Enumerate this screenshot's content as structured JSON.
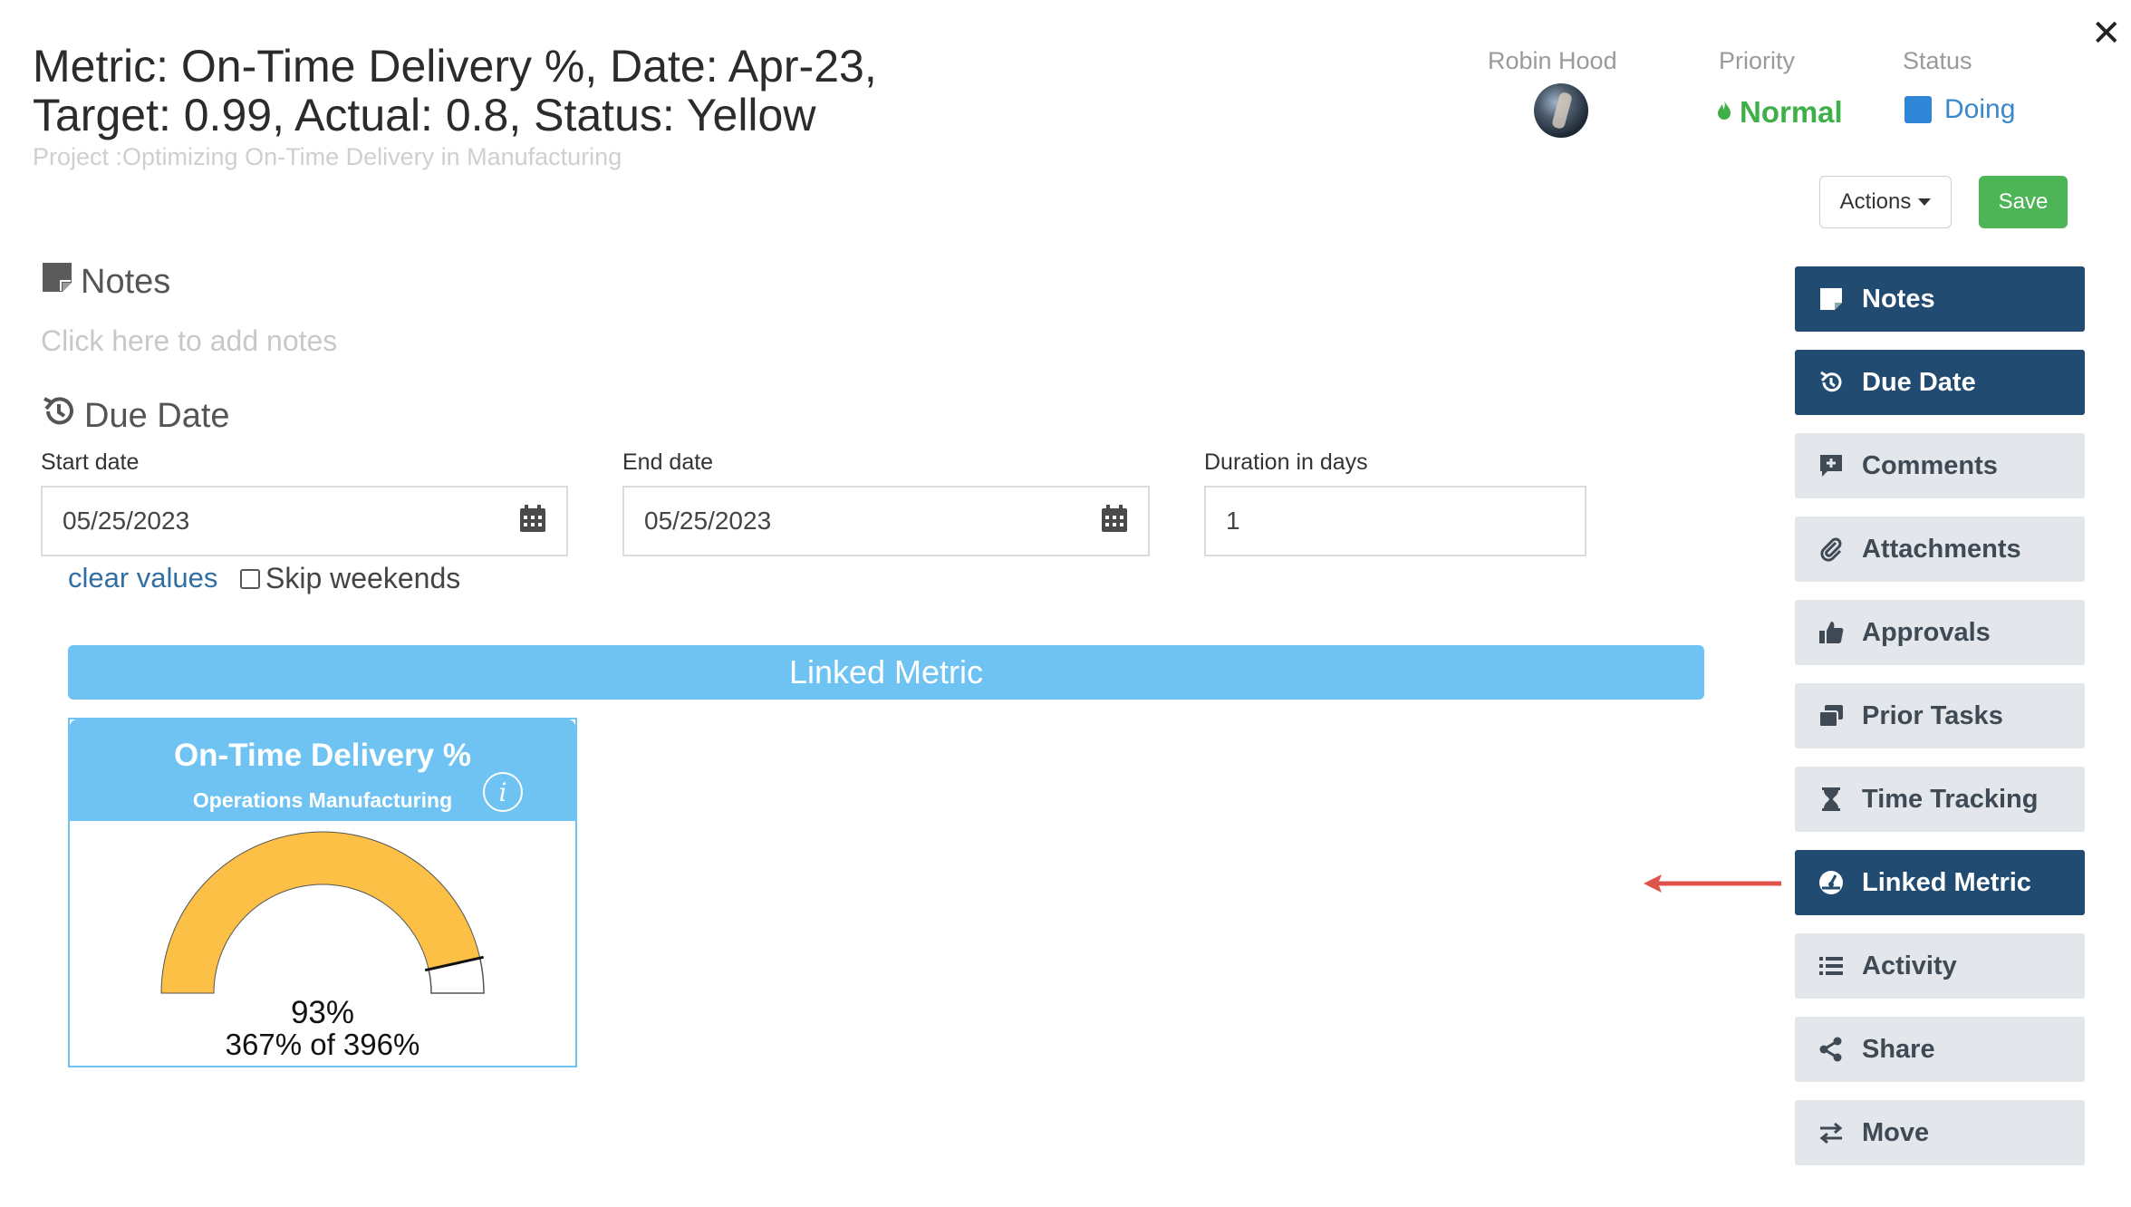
{
  "header": {
    "title_line1": "Metric: On-Time Delivery %, Date: Apr-23,",
    "title_line2": "Target: 0.99, Actual: 0.8, Status: Yellow",
    "project": "Project :Optimizing On-Time Delivery in Manufacturing",
    "assignee_label": "Robin Hood",
    "priority_label": "Priority",
    "priority_value": "Normal",
    "status_label": "Status",
    "status_value": "Doing",
    "close_icon": "close-icon"
  },
  "toolbar": {
    "actions_label": "Actions",
    "save_label": "Save"
  },
  "notes": {
    "title": "Notes",
    "placeholder": "Click here to add notes"
  },
  "due_date": {
    "title": "Due Date",
    "start_label": "Start date",
    "start_value": "05/25/2023",
    "end_label": "End date",
    "end_value": "05/25/2023",
    "duration_label": "Duration in days",
    "duration_value": "1",
    "clear_label": "clear values",
    "skip_weekends_label": "Skip weekends",
    "skip_weekends_checked": false
  },
  "linked_metric": {
    "bar_title": "Linked Metric",
    "card_title": "On-Time Delivery %",
    "card_subtitle": "Operations Manufacturing",
    "gauge_percent_text": "93%",
    "gauge_detail_text": "367% of 396%",
    "gauge_fraction": 0.93,
    "gauge_color": "#fcc047"
  },
  "sidebar": {
    "items": [
      {
        "label": "Notes",
        "icon": "note-icon",
        "active": true
      },
      {
        "label": "Due Date",
        "icon": "history-icon",
        "active": true
      },
      {
        "label": "Comments",
        "icon": "comment-plus-icon",
        "active": false
      },
      {
        "label": "Attachments",
        "icon": "paperclip-icon",
        "active": false
      },
      {
        "label": "Approvals",
        "icon": "thumbs-up-icon",
        "active": false
      },
      {
        "label": "Prior Tasks",
        "icon": "window-stack-icon",
        "active": false
      },
      {
        "label": "Time Tracking",
        "icon": "hourglass-icon",
        "active": false
      },
      {
        "label": "Linked Metric",
        "icon": "gauge-icon",
        "active": true
      },
      {
        "label": "Activity",
        "icon": "list-icon",
        "active": false
      },
      {
        "label": "Share",
        "icon": "share-icon",
        "active": false
      },
      {
        "label": "Move",
        "icon": "swap-icon",
        "active": false
      }
    ]
  },
  "colors": {
    "sidebar_active": "#224b72",
    "sidebar_inactive": "#e3e6ea",
    "accent_blue": "#6fc3f3",
    "save_green": "#4db556",
    "priority_green": "#3fb049",
    "annotation_arrow": "#e0534c"
  }
}
